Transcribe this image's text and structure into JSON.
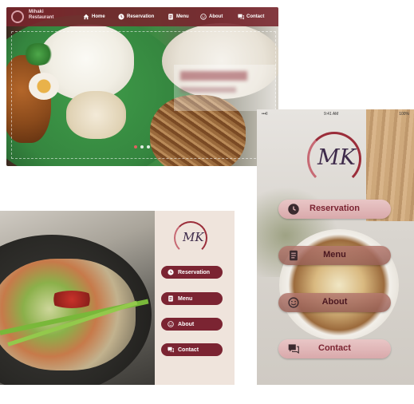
{
  "desktop": {
    "brand": [
      "Mihaki",
      "Restaurant"
    ],
    "nav": [
      {
        "label": "Home",
        "icon": "home-icon"
      },
      {
        "label": "Reservation",
        "icon": "clock-icon"
      },
      {
        "label": "Menu",
        "icon": "menu-book-icon"
      },
      {
        "label": "About",
        "icon": "smile-icon"
      },
      {
        "label": "Contact",
        "icon": "chat-icon"
      }
    ],
    "slider_active_index": 0
  },
  "tablet": {
    "logo_letters": "MK",
    "buttons": [
      {
        "label": "Reservation",
        "icon": "clock-icon"
      },
      {
        "label": "Menu",
        "icon": "menu-book-icon"
      },
      {
        "label": "About",
        "icon": "smile-icon"
      },
      {
        "label": "Contact",
        "icon": "chat-icon"
      }
    ]
  },
  "phone": {
    "status": {
      "left": "•••ll",
      "time": "9:41 AM",
      "right": "100%"
    },
    "logo_letters": "MK",
    "buttons": [
      {
        "label": "Reservation",
        "icon": "clock-icon"
      },
      {
        "label": "Menu",
        "icon": "menu-book-icon"
      },
      {
        "label": "About",
        "icon": "smile-icon"
      },
      {
        "label": "Contact",
        "icon": "chat-icon"
      }
    ]
  },
  "colors": {
    "brand": "#7b2432",
    "nav_bg": "#78242c",
    "panel_bg": "#efe4dc",
    "button_light": "#e2b5b7"
  }
}
